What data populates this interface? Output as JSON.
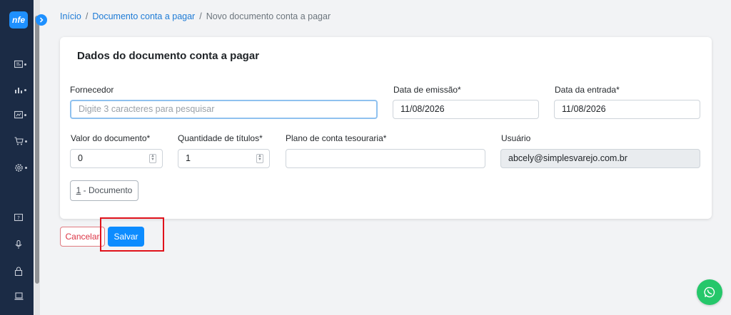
{
  "app": {
    "logo_text": "nfe"
  },
  "breadcrumb": {
    "home": "Início",
    "section": "Documento conta a pagar",
    "current": "Novo documento conta a pagar"
  },
  "card": {
    "title": "Dados do documento conta a pagar",
    "fornecedor": {
      "label": "Fornecedor",
      "placeholder": "Digite 3 caracteres para pesquisar",
      "value": ""
    },
    "data_emissao": {
      "label": "Data de emissão*",
      "value": "11/08/2026"
    },
    "data_entrada": {
      "label": "Data da entrada*",
      "value": "11/08/2026"
    },
    "valor_documento": {
      "label": "Valor do documento*",
      "value": "0"
    },
    "quantidade_titulos": {
      "label": "Quantidade de títulos*",
      "value": "1"
    },
    "plano_conta": {
      "label": "Plano de conta tesouraria*",
      "value": ""
    },
    "usuario": {
      "label": "Usuário",
      "value": "abcely@simplesvarejo.com.br"
    },
    "documento_button": {
      "number": "1",
      "label": " - Documento"
    }
  },
  "actions": {
    "cancel": "Cancelar",
    "save": "Salvar"
  },
  "colors": {
    "sidebar": "#1b2b45",
    "accent": "#0d8cff",
    "danger": "#dc3545",
    "highlight": "#e0121b",
    "whatsapp": "#25c76a"
  },
  "icons": [
    "expand-icon",
    "dashboard-icon",
    "chart-icon",
    "report-icon",
    "cart-icon",
    "settings-icon",
    "feedback-icon",
    "microphone-icon",
    "lock-icon",
    "laptop-icon",
    "whatsapp-icon"
  ]
}
